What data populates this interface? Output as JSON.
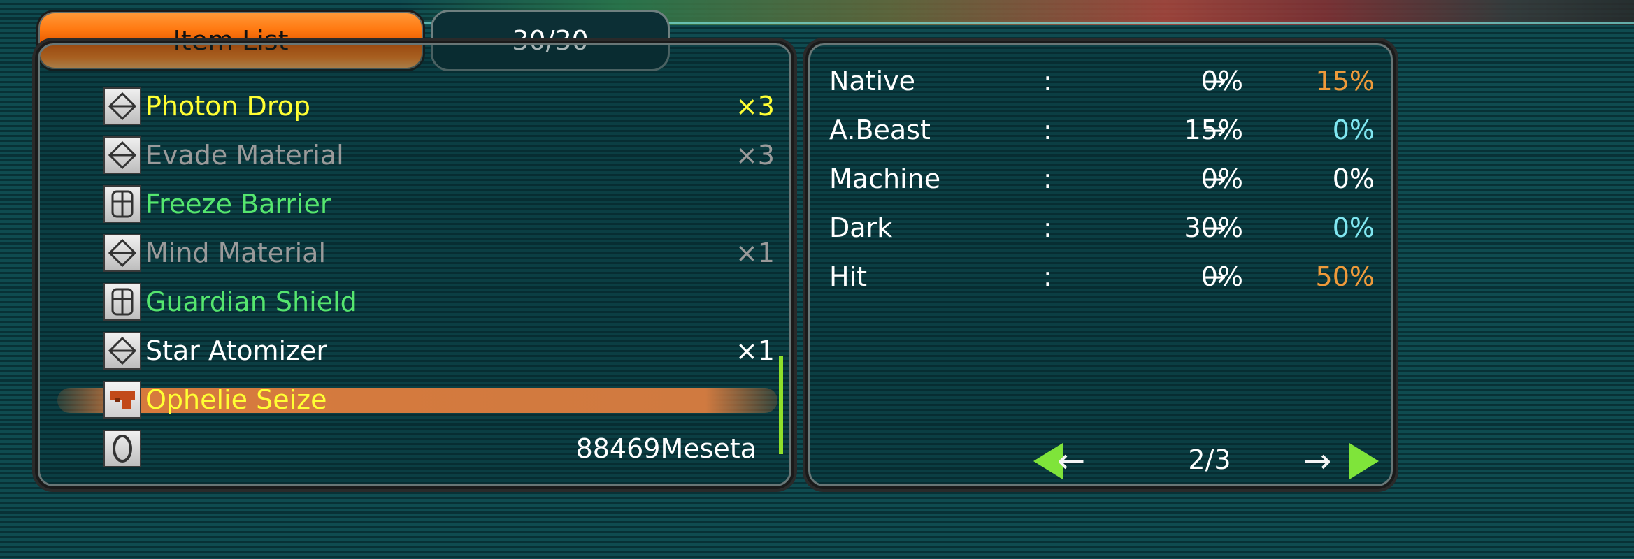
{
  "header": {
    "title": "Item List",
    "count": "30/30"
  },
  "items": [
    {
      "name": "Photon Drop",
      "qty": "×3",
      "icon": "material-diamond-icon",
      "color": "#ffff33"
    },
    {
      "name": "Evade Material",
      "qty": "×3",
      "icon": "material-diamond-icon",
      "color": "#9a9a9a"
    },
    {
      "name": "Freeze Barrier",
      "qty": "",
      "icon": "shield-icon",
      "color": "#55e66e"
    },
    {
      "name": "Mind Material",
      "qty": "×1",
      "icon": "material-diamond-icon",
      "color": "#9a9a9a"
    },
    {
      "name": "Guardian Shield",
      "qty": "",
      "icon": "shield-icon",
      "color": "#55e66e"
    },
    {
      "name": "Star Atomizer",
      "qty": "×1",
      "icon": "material-diamond-icon",
      "color": "#ffffff"
    },
    {
      "name": "Ophelie Seize",
      "qty": "",
      "icon": "gun-icon",
      "color": "#ffff33",
      "selected": true
    }
  ],
  "meseta": {
    "value": "88469Meseta",
    "icon": "meseta-coin-icon"
  },
  "stats": [
    {
      "name": "Native",
      "colon": ":",
      "old": "0%",
      "arrow": "→",
      "new": "15%",
      "new_color": "#ee9a3a"
    },
    {
      "name": "A.Beast",
      "colon": ":",
      "old": "15%",
      "arrow": "→",
      "new": "0%",
      "new_color": "#7fe6f0"
    },
    {
      "name": "Machine",
      "colon": ":",
      "old": "0%",
      "arrow": "→",
      "new": "0%",
      "new_color": "#ffffff"
    },
    {
      "name": "Dark",
      "colon": ":",
      "old": "30%",
      "arrow": "→",
      "new": "0%",
      "new_color": "#7fe6f0"
    },
    {
      "name": "Hit",
      "colon": ":",
      "old": "0%",
      "arrow": "→",
      "new": "50%",
      "new_color": "#ee9a3a"
    }
  ],
  "pager": {
    "page": "2/3"
  },
  "colors": {
    "accent_green": "#7fe43a",
    "title_orange": "#ff7a12"
  }
}
